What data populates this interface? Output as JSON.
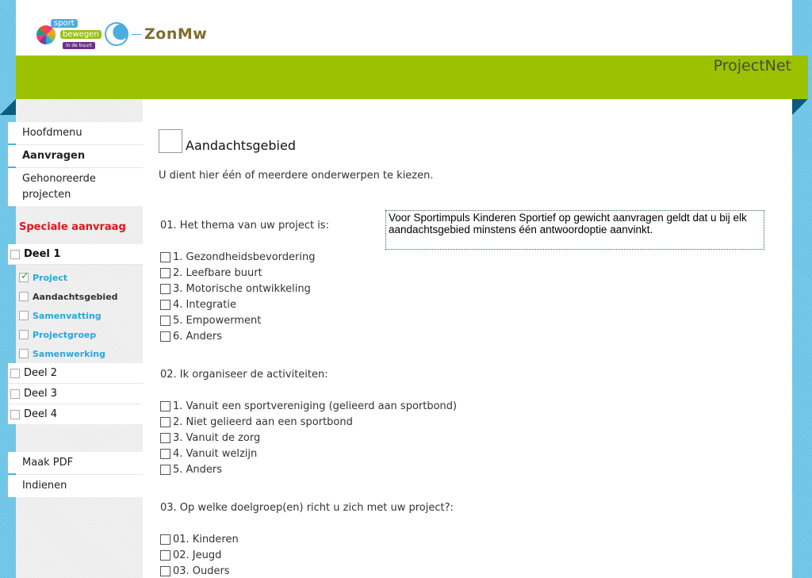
{
  "header": {
    "logo_sport": "sport",
    "logo_bewegen": "bewegen",
    "logo_buurt": "in de buurt",
    "logo_zonmw": "ZonMw",
    "brand": "ProjectNet",
    "colors": {
      "header_green": "#9ac200",
      "side_blue": "#6cc4e6",
      "fold_dark": "#0a5b7c"
    }
  },
  "sidebar": {
    "main_nav": [
      {
        "label": "Hoofdmenu",
        "bold": false
      },
      {
        "label": "Aanvragen",
        "bold": true
      },
      {
        "label": "Gehonoreerde projecten",
        "bold": false
      }
    ],
    "special_label": "Speciale aanvraag",
    "deel1": {
      "label": "Deel 1",
      "checked": false
    },
    "deel1_items": [
      {
        "label": "Project",
        "checked": true,
        "current": false
      },
      {
        "label": "Aandachtsgebied",
        "checked": false,
        "current": true
      },
      {
        "label": "Samenvatting",
        "checked": false,
        "current": false
      },
      {
        "label": "Projectgroep",
        "checked": false,
        "current": false
      },
      {
        "label": "Samenwerking",
        "checked": false,
        "current": false
      }
    ],
    "other_delen": [
      {
        "label": "Deel 2",
        "checked": false
      },
      {
        "label": "Deel 3",
        "checked": false
      },
      {
        "label": "Deel 4",
        "checked": false
      }
    ],
    "actions": [
      {
        "label": "Maak PDF"
      },
      {
        "label": "Indienen"
      }
    ],
    "check_glyph": "✓"
  },
  "main": {
    "title": "Aandachtsgebied",
    "intro": "U dient hier één of meerdere onderwerpen te kiezen.",
    "notice": "Voor Sportimpuls Kinderen Sportief op gewicht aanvragen geldt dat u bij elk aandachtsgebied minstens één antwoordoptie aanvinkt.",
    "questions": [
      {
        "label": "01. Het thema van uw project is:",
        "options": [
          {
            "label": "1. Gezondheidsbevordering",
            "checked": false
          },
          {
            "label": "2. Leefbare buurt",
            "checked": false
          },
          {
            "label": "3. Motorische ontwikkeling",
            "checked": false
          },
          {
            "label": "4. Integratie",
            "checked": false
          },
          {
            "label": "5. Empowerment",
            "checked": false
          },
          {
            "label": "6. Anders",
            "checked": false
          }
        ]
      },
      {
        "label": "02. Ik organiseer de activiteiten:",
        "options": [
          {
            "label": "1. Vanuit een sportvereniging (gelieerd aan sportbond)",
            "checked": false
          },
          {
            "label": "2. Niet gelieerd aan een sportbond",
            "checked": false
          },
          {
            "label": "3. Vanuit de zorg",
            "checked": false
          },
          {
            "label": "4. Vanuit welzijn",
            "checked": false
          },
          {
            "label": "5. Anders",
            "checked": false
          }
        ]
      },
      {
        "label": "03. Op welke doelgroep(en) richt u zich met uw project?:",
        "options": [
          {
            "label": "01. Kinderen",
            "checked": false
          },
          {
            "label": "02. Jeugd",
            "checked": false
          },
          {
            "label": "03. Ouders",
            "checked": false
          }
        ]
      }
    ]
  }
}
